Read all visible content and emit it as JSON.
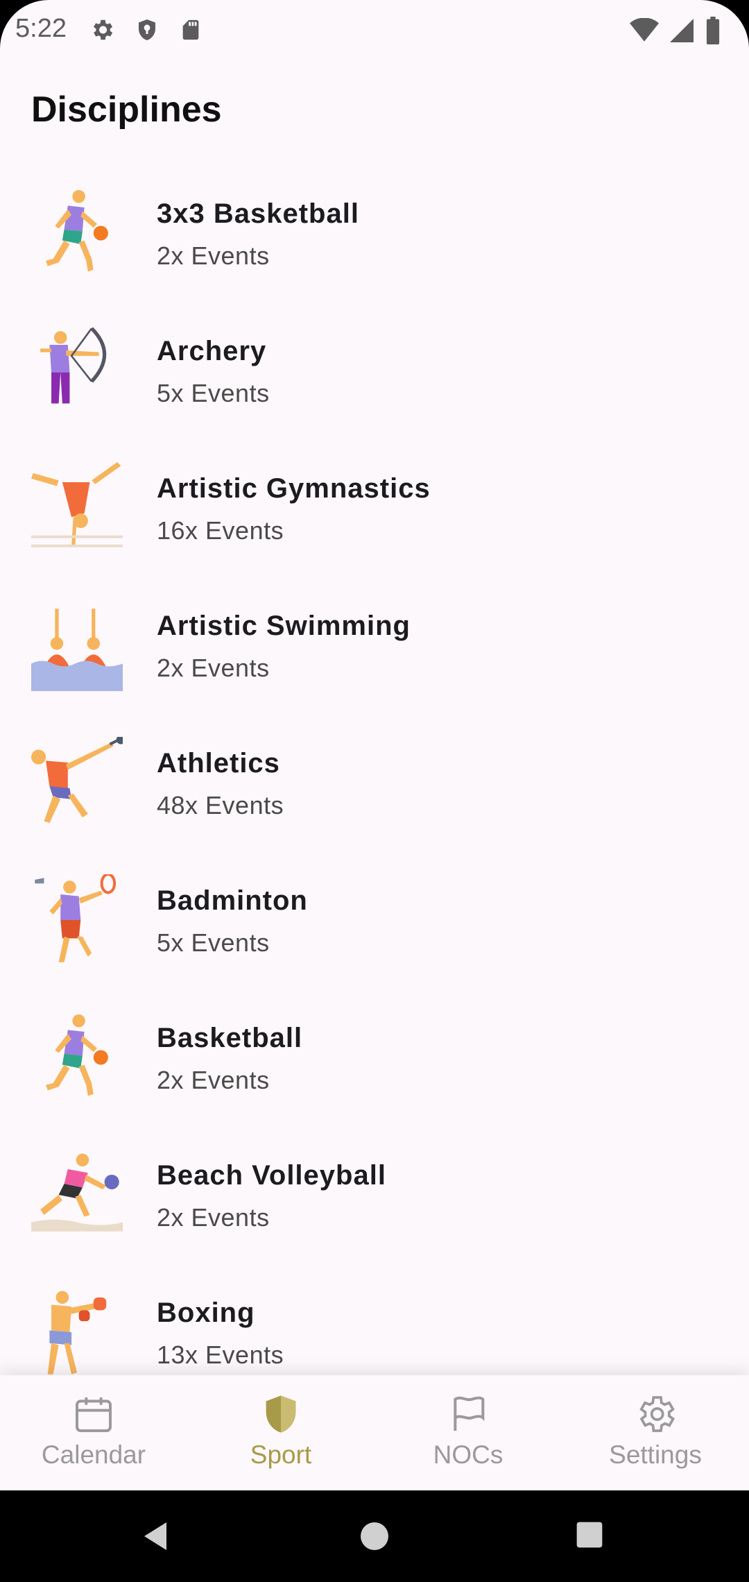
{
  "status_bar": {
    "time": "5:22",
    "left_icons": [
      "settings-icon",
      "shield-icon",
      "sd-card-icon"
    ],
    "right_icons": [
      "wifi-icon",
      "signal-icon",
      "battery-icon"
    ]
  },
  "page": {
    "title": "Disciplines"
  },
  "disciplines": [
    {
      "name": "3x3 Basketball",
      "count": "2x Events",
      "icon": "basketball-player-icon"
    },
    {
      "name": "Archery",
      "count": "5x Events",
      "icon": "archer-icon"
    },
    {
      "name": "Artistic Gymnastics",
      "count": "16x Events",
      "icon": "gymnast-icon"
    },
    {
      "name": "Artistic Swimming",
      "count": "2x Events",
      "icon": "synchronized-swimmers-icon"
    },
    {
      "name": "Athletics",
      "count": "48x Events",
      "icon": "hammer-thrower-icon"
    },
    {
      "name": "Badminton",
      "count": "5x Events",
      "icon": "badminton-player-icon"
    },
    {
      "name": "Basketball",
      "count": "2x Events",
      "icon": "basketball-player-icon"
    },
    {
      "name": "Beach Volleyball",
      "count": "2x Events",
      "icon": "volleyball-player-icon"
    },
    {
      "name": "Boxing",
      "count": "13x Events",
      "icon": "boxer-icon"
    }
  ],
  "bottom_nav": {
    "items": [
      {
        "label": "Calendar",
        "icon": "calendar-icon",
        "active": false
      },
      {
        "label": "Sport",
        "icon": "shield-icon",
        "active": true
      },
      {
        "label": "NOCs",
        "icon": "flag-icon",
        "active": false
      },
      {
        "label": "Settings",
        "icon": "gear-icon",
        "active": false
      }
    ]
  },
  "colors": {
    "active": "#a89a48",
    "inactive": "#9a9a9a",
    "background": "#fdf8fb"
  }
}
